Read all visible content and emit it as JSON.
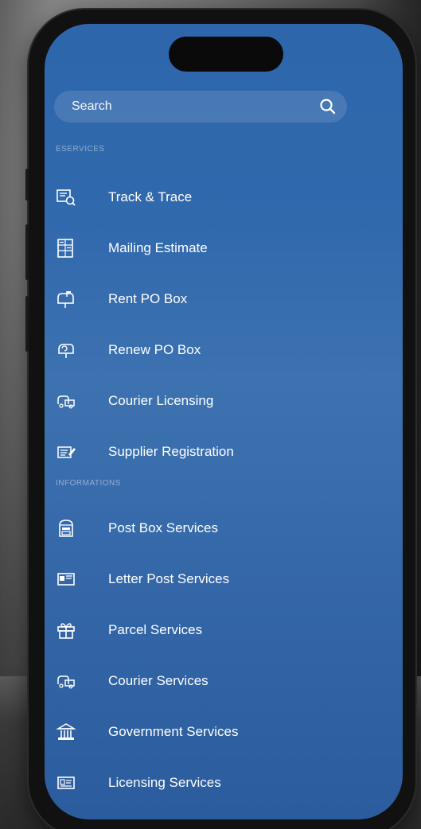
{
  "search": {
    "placeholder": "Search",
    "icon": "search-icon"
  },
  "sections": {
    "eservices": {
      "label": "ESERVICES",
      "items": [
        {
          "label": "Track & Trace",
          "icon": "track-trace-icon"
        },
        {
          "label": "Mailing Estimate",
          "icon": "calculator-icon"
        },
        {
          "label": "Rent PO Box",
          "icon": "mailbox-icon"
        },
        {
          "label": "Renew PO Box",
          "icon": "renew-mailbox-icon"
        },
        {
          "label": "Courier Licensing",
          "icon": "courier-icon"
        },
        {
          "label": "Supplier Registration",
          "icon": "register-form-icon"
        }
      ]
    },
    "informations": {
      "label": "INFORMATIONS",
      "items": [
        {
          "label": "Post Box Services",
          "icon": "post-box-icon"
        },
        {
          "label": "Letter Post Services",
          "icon": "letter-icon"
        },
        {
          "label": "Parcel Services",
          "icon": "parcel-gift-icon"
        },
        {
          "label": "Courier Services",
          "icon": "courier-service-icon"
        },
        {
          "label": "Government Services",
          "icon": "government-building-icon"
        },
        {
          "label": "Licensing Services",
          "icon": "license-card-icon"
        }
      ]
    }
  },
  "colors": {
    "screen_top": "#2e66ab",
    "screen_mid": "#3d72b0",
    "screen_bottom": "#2a5c9e",
    "text": "#ffffff"
  }
}
